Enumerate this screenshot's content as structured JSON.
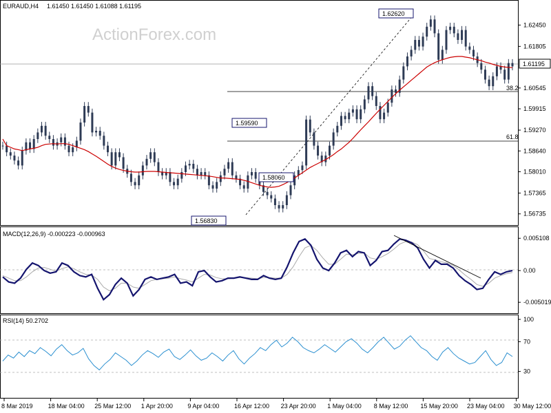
{
  "header": {
    "symbol": "EURAUD,H4",
    "ohlc": "1.61450 1.61450 1.61088 1.61195",
    "watermark": "ActionForex.com"
  },
  "colors": {
    "candles": "#2e3b55",
    "ma": "#cc0000",
    "macd": "#14146e",
    "signal": "#aaaaaa",
    "rsi": "#2a8fd0"
  },
  "chart_data": [
    {
      "type": "candlestick",
      "panel": "price",
      "ylim": [
        1.565,
        1.63
      ],
      "yticks": [
        "1.62450",
        "1.61805",
        "1.61195",
        "1.60545",
        "1.59915",
        "1.59270",
        "1.58640",
        "1.58010",
        "1.57365",
        "1.56735"
      ],
      "current_price": "1.61195",
      "trend_line_labels": [
        "1.62620",
        "1.59590",
        "1.58060",
        "1.56830"
      ],
      "fib_levels": [
        {
          "label": "38.2",
          "value": 1.6035
        },
        {
          "label": "61.8",
          "value": 1.5905
        }
      ],
      "series": [
        {
          "values": [
            1.588,
            1.586,
            1.585,
            1.5835,
            1.582,
            1.5865,
            1.589,
            1.587,
            1.59,
            1.592,
            1.594,
            1.591,
            1.59,
            1.588,
            1.589,
            1.5905,
            1.588,
            1.586,
            1.5875,
            1.5895,
            1.595,
            1.6,
            1.598,
            1.592,
            1.5925,
            1.591,
            1.588,
            1.586,
            1.582,
            1.586,
            1.5845,
            1.581,
            1.5795,
            1.577,
            1.576,
            1.579,
            1.582,
            1.584,
            1.586,
            1.583,
            1.58,
            1.579,
            1.58,
            1.577,
            1.576,
            1.578,
            1.58,
            1.582,
            1.5825,
            1.581,
            1.579,
            1.58,
            1.579,
            1.576,
            1.575,
            1.577,
            1.579,
            1.581,
            1.583,
            1.579,
            1.578,
            1.576,
            1.575,
            1.579,
            1.58,
            1.578,
            1.576,
            1.574,
            1.573,
            1.572,
            1.57,
            1.569,
            1.57,
            1.573,
            1.576,
            1.579,
            1.5806,
            1.582,
            1.5959,
            1.592,
            1.588,
            1.585,
            1.583,
            1.585,
            1.588,
            1.592,
            1.594,
            1.597,
            1.596,
            1.598,
            1.599,
            1.596,
            1.599,
            1.602,
            1.606,
            1.603,
            1.6,
            1.596,
            1.598,
            1.601,
            1.605,
            1.604,
            1.608,
            1.612,
            1.615,
            1.617,
            1.62,
            1.618,
            1.621,
            1.624,
            1.6262,
            1.622,
            1.614,
            1.617,
            1.623,
            1.624,
            1.622,
            1.62,
            1.623,
            1.618,
            1.617,
            1.615,
            1.613,
            1.611,
            1.608,
            1.606,
            1.609,
            1.612,
            1.611,
            1.608,
            1.613,
            1.612
          ],
          "name": ""
        },
        {
          "values": [
            1.59,
            1.588,
            1.5875,
            1.587,
            1.5868,
            1.5865,
            1.5868,
            1.587,
            1.5872,
            1.5875,
            1.588,
            1.5884,
            1.5885,
            1.5886,
            1.5885,
            1.5886,
            1.5886,
            1.5884,
            1.588,
            1.5876,
            1.5872,
            1.5868,
            1.5862,
            1.5855,
            1.5848,
            1.584,
            1.5832,
            1.5824,
            1.5817,
            1.5812,
            1.5808,
            1.5805,
            1.5803,
            1.5801,
            1.58,
            1.58,
            1.5801,
            1.5802,
            1.5802,
            1.5802,
            1.5801,
            1.58,
            1.5799,
            1.5798,
            1.5797,
            1.5796,
            1.5795,
            1.5794,
            1.5793,
            1.5792,
            1.5791,
            1.579,
            1.5789,
            1.5788,
            1.5786,
            1.5784,
            1.5782,
            1.5782,
            1.5781,
            1.578,
            1.5779,
            1.5778,
            1.5775,
            1.5772,
            1.5768,
            1.5764,
            1.576,
            1.5757,
            1.5755,
            1.5754,
            1.5755,
            1.5757,
            1.5762,
            1.5768,
            1.5775,
            1.5782,
            1.579,
            1.5798,
            1.5806,
            1.5814,
            1.582,
            1.5826,
            1.5832,
            1.5838,
            1.5845,
            1.5853,
            1.5862,
            1.587,
            1.588,
            1.589,
            1.5902,
            1.5915,
            1.5928,
            1.594,
            1.5952,
            1.5965,
            1.5978,
            1.599,
            1.6002,
            1.6014,
            1.6026,
            1.6037,
            1.6048,
            1.6058,
            1.6068,
            1.6078,
            1.6088,
            1.6098,
            1.6108,
            1.6118,
            1.6125,
            1.6131,
            1.6136,
            1.614,
            1.6144,
            1.6147,
            1.6149,
            1.615,
            1.615,
            1.6148,
            1.6146,
            1.6143,
            1.614,
            1.6137,
            1.6133,
            1.613,
            1.6126,
            1.6123,
            1.612,
            1.6118,
            1.6117,
            1.6116
          ],
          "name": ""
        }
      ]
    },
    {
      "type": "line",
      "panel": "macd",
      "title": "MACD(12,26,9) -0.000223 -0.000963",
      "ylim": [
        -0.0062,
        0.006
      ],
      "yticks": [
        "0.005108",
        "0.00",
        "-0.005019"
      ],
      "series": [
        {
          "name": "",
          "values": [
            -0.001,
            -0.0018,
            -0.002,
            -0.0012,
            0.0002,
            0.0012,
            0.0008,
            0.0,
            -0.0004,
            -0.0002,
            0.0012,
            0.0008,
            -0.0002,
            -0.0008,
            -0.001,
            -0.0006,
            -0.0028,
            -0.0046,
            -0.0038,
            -0.0022,
            -0.0012,
            -0.002,
            -0.004,
            -0.003,
            -0.0014,
            -0.001,
            -0.0014,
            -0.0012,
            -0.001,
            -0.0006,
            -0.002,
            -0.0018,
            -0.0024,
            -0.0002,
            0.0,
            -0.001,
            -0.0018,
            -0.0016,
            -0.0012,
            -0.0012,
            -0.001,
            -0.0012,
            -0.0014,
            -0.0014,
            -0.0008,
            -0.0012,
            -0.0014,
            -0.0012,
            0.0006,
            0.0028,
            0.0046,
            0.005,
            0.004,
            0.0018,
            0.0004,
            0.0,
            0.0012,
            0.0028,
            0.0032,
            0.0022,
            0.003,
            0.0028,
            0.0008,
            0.0016,
            0.003,
            0.0032,
            0.0042,
            0.005,
            0.0048,
            0.0044,
            0.0036,
            0.0018,
            0.0004,
            0.0016,
            0.001,
            0.001,
            0.0004,
            -0.0008,
            -0.0016,
            -0.0022,
            -0.003,
            -0.0028,
            -0.0014,
            -0.0002,
            -0.0006,
            -0.0002,
            0.0
          ]
        },
        {
          "name": "",
          "values": [
            -0.0008,
            -0.0012,
            -0.0016,
            -0.0016,
            -0.001,
            -0.0002,
            0.0004,
            0.0005,
            0.0002,
            -0.0001,
            0.0003,
            0.0006,
            0.0003,
            -0.0002,
            -0.0006,
            -0.0007,
            -0.0014,
            -0.0026,
            -0.0032,
            -0.0028,
            -0.002,
            -0.002,
            -0.0026,
            -0.0028,
            -0.0022,
            -0.0016,
            -0.0014,
            -0.0013,
            -0.0012,
            -0.001,
            -0.0013,
            -0.0015,
            -0.0018,
            -0.0012,
            -0.0006,
            -0.0007,
            -0.0011,
            -0.0013,
            -0.0013,
            -0.0012,
            -0.0011,
            -0.0011,
            -0.0012,
            -0.0013,
            -0.0011,
            -0.0011,
            -0.0012,
            -0.0012,
            -0.0006,
            0.0006,
            0.0022,
            0.0036,
            0.004,
            0.0032,
            0.002,
            0.001,
            0.001,
            0.0018,
            0.0026,
            0.0025,
            0.0027,
            0.0028,
            0.002,
            0.0018,
            0.0022,
            0.0027,
            0.0034,
            0.0042,
            0.0046,
            0.0045,
            0.0041,
            0.0031,
            0.0019,
            0.0017,
            0.0014,
            0.0012,
            0.0008,
            0.0001,
            -0.0007,
            -0.0014,
            -0.0022,
            -0.0025,
            -0.002,
            -0.0012,
            -0.0008,
            -0.0005,
            -0.0003
          ]
        }
      ]
    },
    {
      "type": "line",
      "panel": "rsi",
      "title": "RSI(14) 50.2702",
      "ylim": [
        0,
        100
      ],
      "yticks": [
        "100",
        "70",
        "30"
      ],
      "levels": [
        70,
        30
      ],
      "series": [
        {
          "name": "",
          "values": [
            44,
            52,
            48,
            56,
            50,
            58,
            54,
            62,
            57,
            51,
            60,
            66,
            58,
            52,
            55,
            61,
            47,
            38,
            32,
            40,
            46,
            55,
            50,
            45,
            38,
            44,
            52,
            58,
            54,
            49,
            56,
            60,
            50,
            46,
            52,
            59,
            51,
            45,
            48,
            55,
            50,
            44,
            52,
            58,
            47,
            40,
            48,
            54,
            62,
            58,
            66,
            72,
            63,
            68,
            76,
            70,
            62,
            58,
            55,
            60,
            66,
            61,
            56,
            63,
            70,
            74,
            68,
            60,
            55,
            62,
            70,
            76,
            68,
            60,
            64,
            72,
            78,
            70,
            62,
            58,
            50,
            45,
            56,
            62,
            54,
            48,
            44,
            40,
            42,
            50,
            58,
            46,
            38,
            42,
            55,
            50
          ]
        }
      ]
    }
  ],
  "x_axis": {
    "labels": [
      "8 Mar 2019",
      "18 Mar 04:00",
      "25 Mar 12:00",
      "1 Apr 20:00",
      "9 Apr 04:00",
      "16 Apr 12:00",
      "23 Apr 20:00",
      "1 May 04:00",
      "8 May 12:00",
      "15 May 20:00",
      "23 May 04:00",
      "30 May 12:00"
    ]
  }
}
